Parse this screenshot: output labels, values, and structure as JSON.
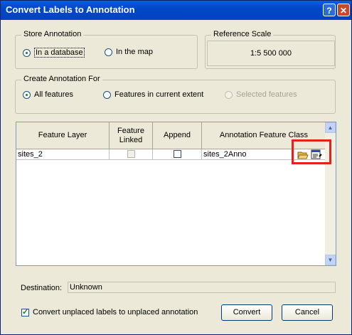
{
  "window": {
    "title": "Convert Labels to Annotation",
    "help_glyph": "?",
    "close_glyph": "✕"
  },
  "store": {
    "label": "Store Annotation",
    "options": [
      {
        "label": "In a database",
        "selected": true
      },
      {
        "label": "In the map",
        "selected": false
      }
    ]
  },
  "reference": {
    "label": "Reference Scale",
    "value": "1:5 500 000"
  },
  "create_for": {
    "label": "Create Annotation For",
    "options": [
      {
        "label": "All features",
        "selected": true,
        "enabled": true
      },
      {
        "label": "Features in current extent",
        "selected": false,
        "enabled": true
      },
      {
        "label": "Selected features",
        "selected": false,
        "enabled": false
      }
    ]
  },
  "table": {
    "headers": [
      "Feature Layer",
      "Feature Linked",
      "Append",
      "Annotation Feature Class"
    ],
    "rows": [
      {
        "layer": "sites_2",
        "feature_linked": false,
        "append": false,
        "annotation_class": "sites_2Anno"
      }
    ]
  },
  "icons": {
    "open": "folder-open-icon",
    "properties": "properties-icon",
    "scroll_up": "▲",
    "scroll_down": "▼"
  },
  "destination": {
    "label": "Destination:",
    "value": "Unknown"
  },
  "unplaced": {
    "label": "Convert unplaced labels to unplaced annotation",
    "checked": true
  },
  "buttons": {
    "convert": "Convert",
    "cancel": "Cancel"
  },
  "colors": {
    "highlight": "#e8201c",
    "titlebar": "#0047c8"
  }
}
